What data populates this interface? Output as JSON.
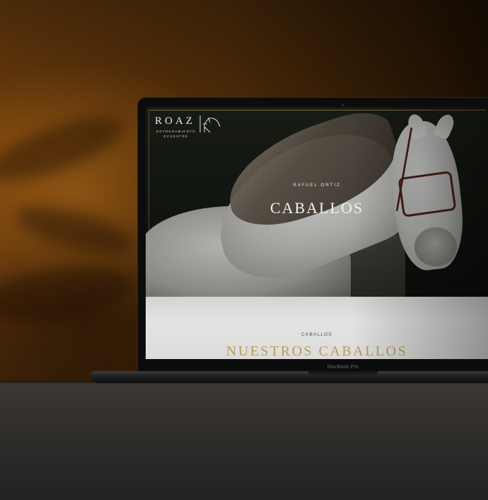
{
  "site": {
    "logo": {
      "wordmark": "ROAZ",
      "tagline_line1": "ENTRENAMIENTO",
      "tagline_line2": "ECUESTRE",
      "mark_icon": "horse-ear-monogram-icon"
    },
    "hero": {
      "kicker": "RAFAEL ORTIZ",
      "title": "CABALLOS"
    },
    "section": {
      "kicker": "CABALLOS",
      "title": "NUESTROS CABALLOS"
    },
    "colors": {
      "gold": "#b99a5e",
      "hero_text": "#f4f2ec",
      "section_bg": "#e0e0de"
    }
  },
  "device": {
    "model_label": "MacBook Pro"
  }
}
